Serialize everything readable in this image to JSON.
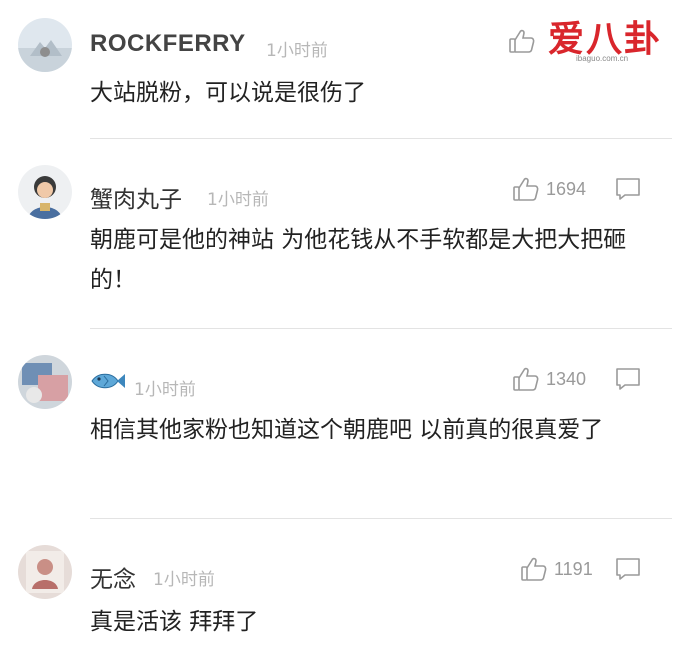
{
  "comments": [
    {
      "username": "ROCKFERRY",
      "time": "1小时前",
      "text": "大站脱粉，可以说是很伤了",
      "likes": ""
    },
    {
      "username": "蟹肉丸子",
      "time": "1小时前",
      "text": "朝鹿可是他的神站 为他花钱从不手软都是大把大把砸的！",
      "likes": "1694"
    },
    {
      "username": "",
      "username_icon": "fish-emoji",
      "time": "1小时前",
      "text": "相信其他家粉也知道这个朝鹿吧  以前真的很真爱了",
      "likes": "1340"
    },
    {
      "username": "无念",
      "time": "1小时前",
      "text": "真是活该 拜拜了",
      "likes": "1191"
    }
  ],
  "watermark": {
    "brand": "爱八卦",
    "url": "ibaguo.com.cn"
  },
  "colors": {
    "username": "#333333",
    "time": "#b7b7b7",
    "divider": "#e3e3e3",
    "watermark": "#d9262c"
  },
  "icons": [
    "thumbs-up-icon",
    "reply-bubble-icon",
    "fish-icon"
  ]
}
